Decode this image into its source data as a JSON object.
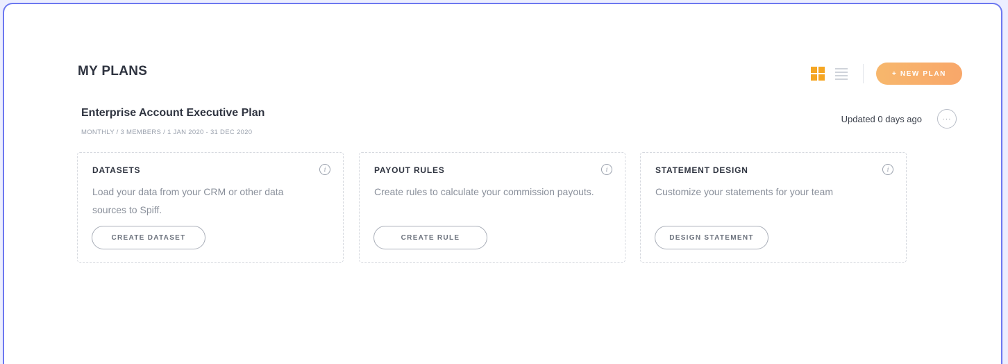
{
  "header": {
    "title": "MY PLANS",
    "new_plan_label": "+ NEW PLAN",
    "view_icons": [
      "grid-view-icon",
      "list-view-icon"
    ],
    "accent_color": "#f5a623"
  },
  "plan": {
    "name": "Enterprise Account Executive Plan",
    "meta": "MONTHLY / 3 MEMBERS / 1 JAN 2020 - 31 DEC 2020",
    "updated": "Updated 0 days ago",
    "more_label": "···"
  },
  "cards": [
    {
      "title": "DATASETS",
      "description": "Load your data from your CRM or other data sources to Spiff.",
      "button": "CREATE DATASET",
      "info": "i"
    },
    {
      "title": "PAYOUT RULES",
      "description": "Create rules to calculate your commission payouts.",
      "button": "CREATE RULE",
      "info": "i"
    },
    {
      "title": "STATEMENT DESIGN",
      "description": "Customize your statements for your team",
      "button": "DESIGN STATEMENT",
      "info": "i"
    }
  ]
}
